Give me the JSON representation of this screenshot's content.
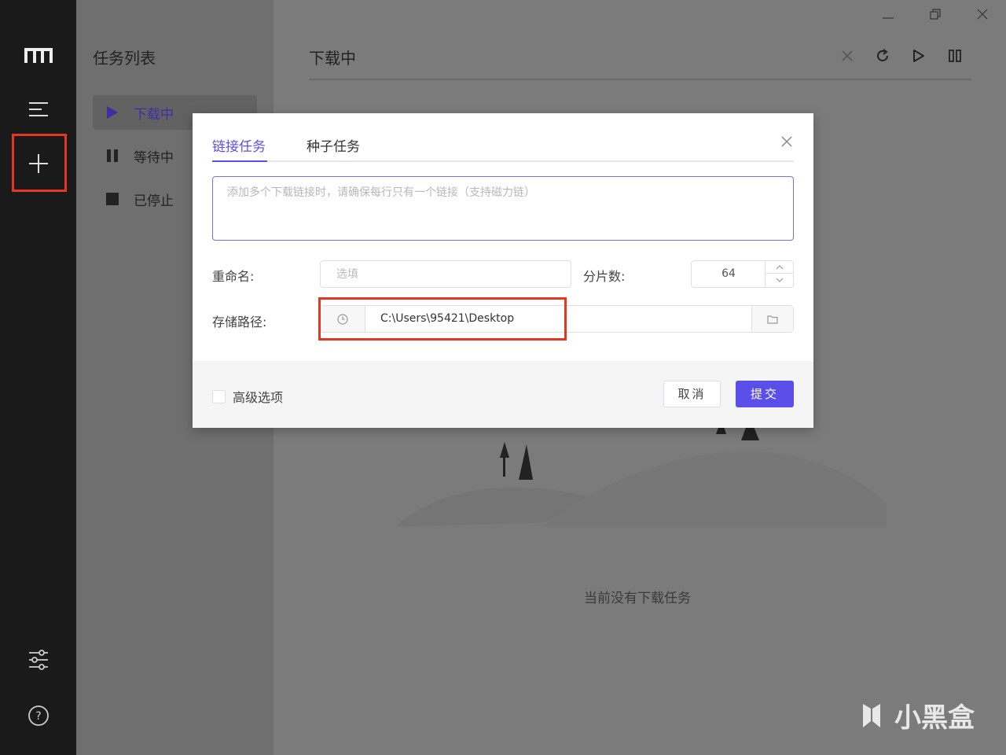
{
  "sidebar": {
    "icons": [
      "motrix-logo-icon",
      "menu-icon",
      "plus-icon",
      "preferences-icon",
      "help-icon"
    ]
  },
  "tasklist": {
    "title": "任务列表",
    "items": [
      {
        "label": "下载中",
        "icon": "play-icon",
        "active": true
      },
      {
        "label": "等待中",
        "icon": "pause-icon",
        "active": false
      },
      {
        "label": "已停止",
        "icon": "stop-icon",
        "active": false
      }
    ]
  },
  "main": {
    "title": "下载中",
    "empty_text": "当前没有下载任务",
    "toolbar_icons": [
      "close-icon",
      "refresh-icon",
      "resume-icon",
      "pause-all-icon"
    ]
  },
  "window_controls": [
    "minimize-icon",
    "restore-icon",
    "close-icon"
  ],
  "dialog": {
    "tabs": [
      "链接任务",
      "种子任务"
    ],
    "active_tab": 0,
    "urls_placeholder": "添加多个下载链接时，请确保每行只有一个链接（支持磁力链）",
    "rename_label": "重命名:",
    "rename_placeholder": "选填",
    "split_label": "分片数:",
    "split_value": "64",
    "path_label": "存储路径:",
    "path_value": "C:\\Users\\95421\\Desktop",
    "advanced_label": "高级选项",
    "cancel_label": "取消",
    "submit_label": "提交"
  },
  "watermark": {
    "text": "小黑盒"
  },
  "colors": {
    "accent": "#5b4fe9",
    "highlight": "#e53622",
    "rail": "#1a1a1a"
  }
}
